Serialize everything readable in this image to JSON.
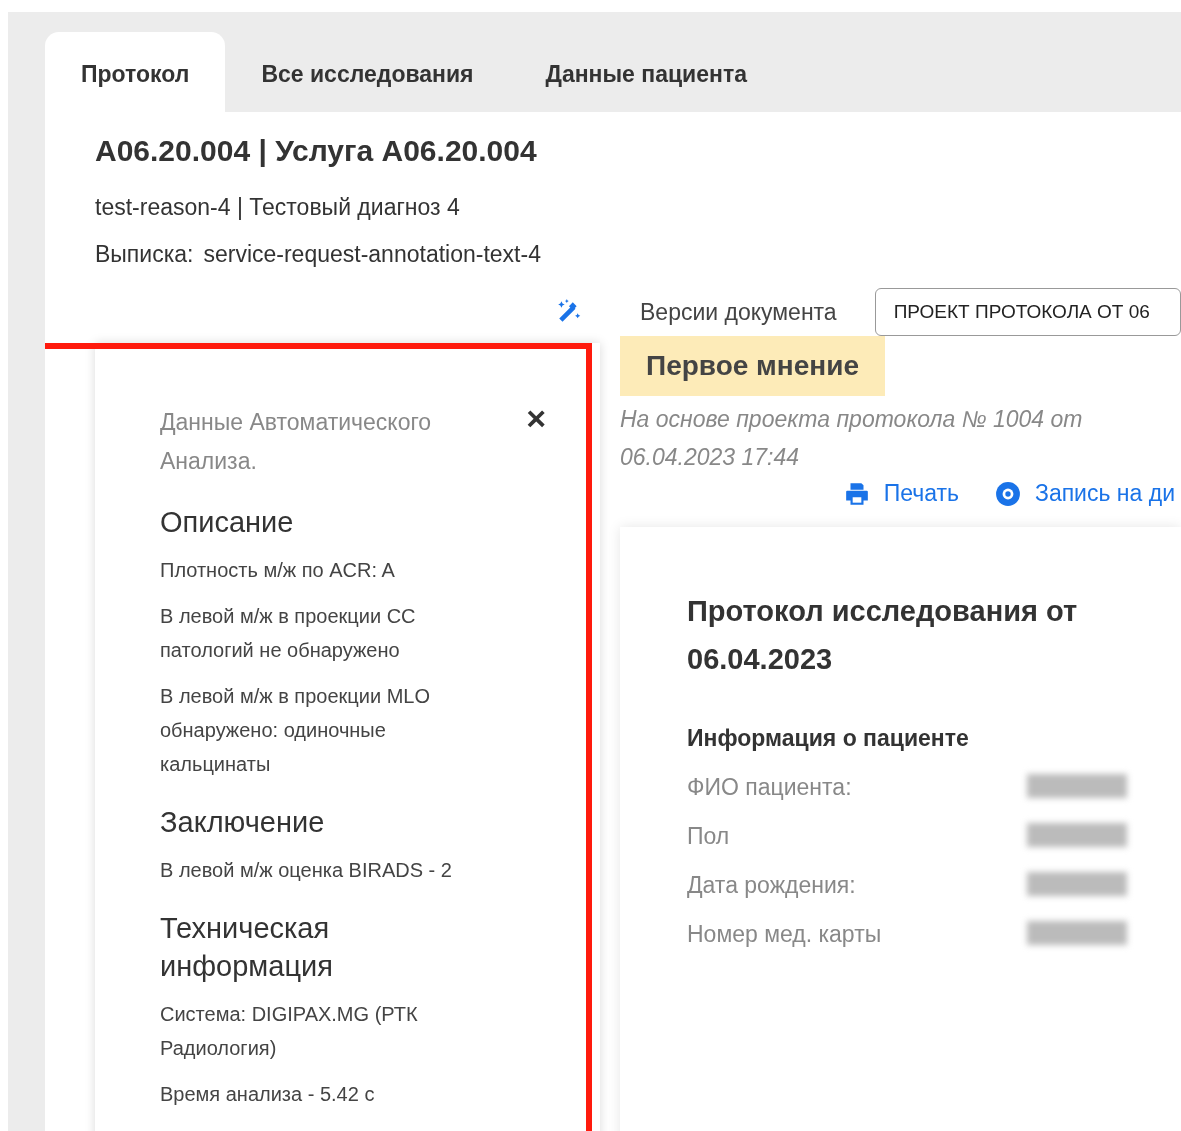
{
  "tabs": [
    {
      "label": "Протокол",
      "selected": true
    },
    {
      "label": "Все исследования",
      "selected": false
    },
    {
      "label": "Данные пациента",
      "selected": false
    }
  ],
  "header": {
    "title": "A06.20.004 | Услуга A06.20.004",
    "reason": "test-reason-4 | Тестовый диагноз 4",
    "extract_label": "Выписка:",
    "extract_value": "service-request-annotation-text-4"
  },
  "analysis_panel": {
    "title": "Данные Автоматического Анализа.",
    "close": "×",
    "highlighted": true,
    "sections": [
      {
        "heading": "Описание",
        "paragraphs": [
          "Плотность м/ж по ACR: A",
          "В левой м/ж в проекции CC патологий не обнаружено",
          "В левой м/ж в проекции MLO обнаружено: одиночные кальцинаты"
        ]
      },
      {
        "heading": "Заключение",
        "paragraphs": [
          "В левой м/ж оценка BIRADS - 2"
        ]
      },
      {
        "heading": "Техническая информация",
        "paragraphs": [
          "Система: DIGIPAX.MG (РТК Радиология)",
          "Время анализа - 5.42 с"
        ]
      }
    ]
  },
  "versions": {
    "label": "Версии документа",
    "select_value": "ПРОЕКТ ПРОТОКОЛА ОТ 06"
  },
  "opinion_badge": "Первое мнение",
  "based_on": "На основе проекта протокола № 1004 от 06.04.2023 17:44",
  "actions": [
    {
      "kind": "print",
      "label": "Печать"
    },
    {
      "kind": "disc",
      "label": "Запись на ди"
    }
  ],
  "document": {
    "title": "Протокол исследования  от 06.04.2023",
    "section": "Информация о пациенте",
    "rows": [
      {
        "label": "ФИО пациента:",
        "value_blurred": true
      },
      {
        "label": "Пол",
        "value_blurred": true
      },
      {
        "label": "Дата рождения:",
        "value_blurred": true
      },
      {
        "label": "Номер мед. карты",
        "value_blurred": true
      }
    ]
  }
}
